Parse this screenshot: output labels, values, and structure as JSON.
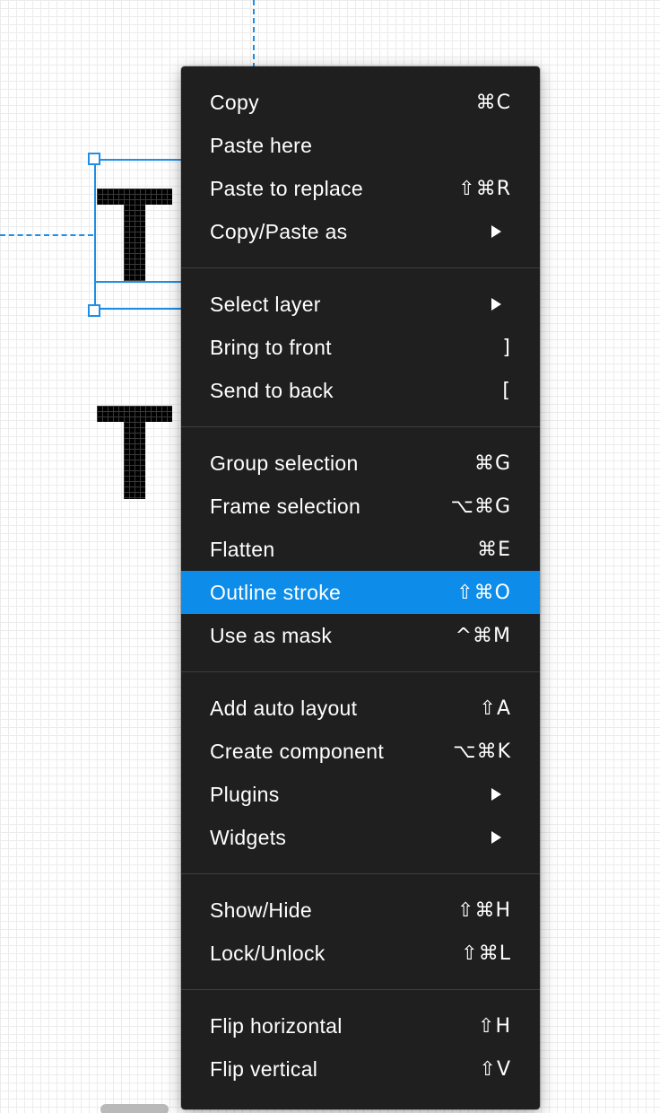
{
  "canvas": {
    "glyph_one": "T",
    "glyph_two": "T"
  },
  "context_menu": {
    "sections": [
      {
        "items": [
          {
            "label": "Copy",
            "shortcut": "⌘C"
          },
          {
            "label": "Paste here",
            "shortcut": ""
          },
          {
            "label": "Paste to replace",
            "shortcut": "⇧⌘R"
          },
          {
            "label": "Copy/Paste as",
            "shortcut": "",
            "submenu": true
          }
        ]
      },
      {
        "items": [
          {
            "label": "Select layer",
            "shortcut": "",
            "submenu": true
          },
          {
            "label": "Bring to front",
            "shortcut": "]"
          },
          {
            "label": "Send to back",
            "shortcut": "["
          }
        ]
      },
      {
        "items": [
          {
            "label": "Group selection",
            "shortcut": "⌘G"
          },
          {
            "label": "Frame selection",
            "shortcut": "⌥⌘G"
          },
          {
            "label": "Flatten",
            "shortcut": "⌘E"
          },
          {
            "label": "Outline stroke",
            "shortcut": "⇧⌘O",
            "highlighted": true
          },
          {
            "label": "Use as mask",
            "shortcut": "^⌘M"
          }
        ]
      },
      {
        "items": [
          {
            "label": "Add auto layout",
            "shortcut": "⇧A"
          },
          {
            "label": "Create component",
            "shortcut": "⌥⌘K"
          },
          {
            "label": "Plugins",
            "shortcut": "",
            "submenu": true
          },
          {
            "label": "Widgets",
            "shortcut": "",
            "submenu": true
          }
        ]
      },
      {
        "items": [
          {
            "label": "Show/Hide",
            "shortcut": "⇧⌘H"
          },
          {
            "label": "Lock/Unlock",
            "shortcut": "⇧⌘L"
          }
        ]
      },
      {
        "items": [
          {
            "label": "Flip horizontal",
            "shortcut": "⇧H"
          },
          {
            "label": "Flip vertical",
            "shortcut": "⇧V"
          }
        ]
      }
    ]
  },
  "colors": {
    "menu_background": "#1f1f1f",
    "highlight": "#0d8ce9",
    "selection": "#1e8ee6",
    "divider": "#3e3e3e"
  }
}
